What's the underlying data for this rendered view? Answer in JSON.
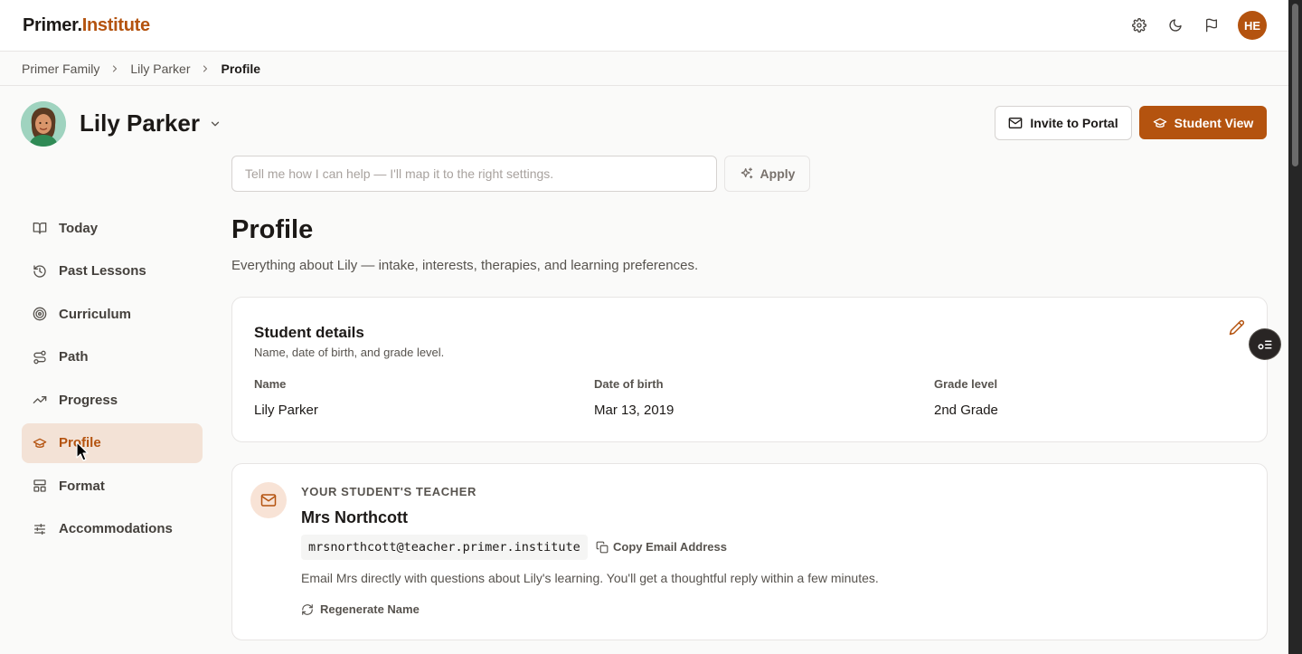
{
  "brand": {
    "part1": "Primer.",
    "part2": "Institute"
  },
  "topbar": {
    "icons": [
      "settings-icon",
      "moon-icon",
      "flag-icon"
    ],
    "avatar_initials": "HE"
  },
  "breadcrumb": {
    "items": [
      "Primer Family",
      "Lily Parker"
    ],
    "current": "Profile"
  },
  "student": {
    "name": "Lily Parker"
  },
  "header_actions": {
    "invite_label": "Invite to Portal",
    "student_view_label": "Student View"
  },
  "assistant": {
    "placeholder": "Tell me how I can help — I'll map it to the right settings.",
    "value": "",
    "apply_label": "Apply"
  },
  "sidebar": {
    "items": [
      {
        "label": "Today",
        "icon": "book-open-icon",
        "active": false
      },
      {
        "label": "Past Lessons",
        "icon": "history-icon",
        "active": false
      },
      {
        "label": "Curriculum",
        "icon": "target-icon",
        "active": false
      },
      {
        "label": "Path",
        "icon": "route-icon",
        "active": false
      },
      {
        "label": "Progress",
        "icon": "trending-up-icon",
        "active": false
      },
      {
        "label": "Profile",
        "icon": "graduation-cap-icon",
        "active": true
      },
      {
        "label": "Format",
        "icon": "layout-icon",
        "active": false
      },
      {
        "label": "Accommodations",
        "icon": "sliders-icon",
        "active": false
      }
    ]
  },
  "page": {
    "title": "Profile",
    "subtitle": "Everything about Lily — intake, interests, therapies, and learning preferences."
  },
  "student_details": {
    "title": "Student details",
    "subtitle": "Name, date of birth, and grade level.",
    "fields": [
      {
        "label": "Name",
        "value": "Lily Parker"
      },
      {
        "label": "Date of birth",
        "value": "Mar 13, 2019"
      },
      {
        "label": "Grade level",
        "value": "2nd Grade"
      }
    ]
  },
  "teacher": {
    "kicker": "YOUR STUDENT'S TEACHER",
    "name": "Mrs Northcott",
    "email": "mrsnorthcott@teacher.primer.institute",
    "copy_label": "Copy Email Address",
    "note": "Email Mrs directly with questions about Lily's learning. You'll get a thoughtful reply within a few minutes.",
    "regenerate_label": "Regenerate Name"
  },
  "colors": {
    "accent": "#b4530f",
    "accent_soft": "#f3e2d6",
    "text": "#1c1917",
    "muted": "#57534e"
  }
}
